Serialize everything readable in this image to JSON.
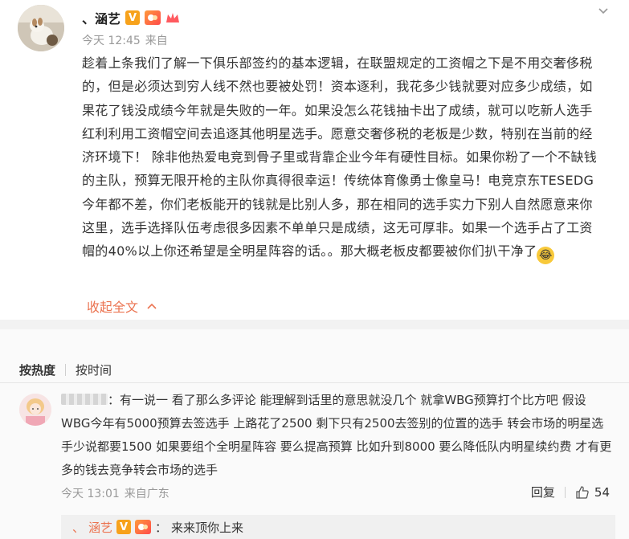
{
  "post": {
    "author": "、涵艺",
    "time": "今天 12:45",
    "source": "来自",
    "paragraph": "趁着上条我们了解一下俱乐部签约的基本逻辑，在联盟规定的工资帽之下是不用交奢侈税的，但是必须达到穷人线不然也要被处罚！资本逐利，我花多少钱就要对应多少成绩，如果花了钱没成绩今年就是失败的一年。如果没怎么花钱抽卡出了成绩，就可以吃新人选手红利利用工资帽空间去追逐其他明星选手。愿意交奢侈税的老板是少数，特别在当前的经济环境下！ 除非他热爱电竞到骨子里或背靠企业今年有硬性目标。如果你粉了一个不缺钱的主队，预算无限开枪的主队你真得很幸运！传统体育像勇士像皇马！电竞京东TESEDG今年都不差，你们老板能开的钱就是比别人多，那在相同的选手实力下别人自然愿意来你这里，选手选择队伍考虑很多因素不单单只是成绩，这无可厚非。如果一个选手占了工资帽的40%以上你还希望是全明星阵容的话。。那大概老板皮都要被你们扒干净了",
    "collapse_label": "收起全文",
    "icons": {
      "verified": "verified-v-icon",
      "vip": "svip-icon",
      "crown": "crown-icon",
      "more": "chevron-down-icon",
      "emoji": "laugh-cry-emoji",
      "collapse": "chevron-up-icon"
    }
  },
  "comments": {
    "sort_hot": "按热度",
    "sort_time": "按时间",
    "items": [
      {
        "separator": "：",
        "text": "有一说一 看了那么多评论 能理解到话里的意思就没几个 就拿WBG预算打个比方吧 假设WBG今年有5000预算去签选手 上路花了2500 剩下只有2500去签别的位置的选手 转会市场的明星选手少说都要1500 如果要组个全明星阵容 要么提高预算 比如升到8000 要么降低队内明星续约费 才有更多的钱去竞争转会市场的选手",
        "time": "今天 13:01",
        "source": "来自广东",
        "reply_label": "回复",
        "likes": "54",
        "sub_reply": {
          "name": "涵艺",
          "separator": "：",
          "text": "来来顶你上来"
        }
      }
    ]
  },
  "colors": {
    "accent": "#eb7350",
    "text": "#333333",
    "muted": "#999999",
    "separator": "#f2f2f2"
  }
}
